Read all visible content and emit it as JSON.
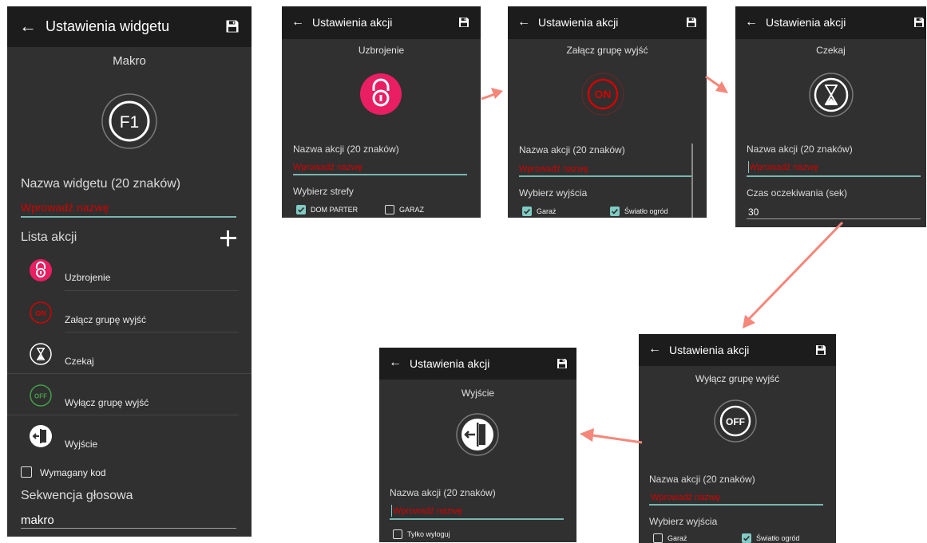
{
  "widget_screen": {
    "title": "Ustawienia widgetu",
    "subtitle": "Makro",
    "name_label": "Nazwa widgetu (20 znaków)",
    "name_placeholder": "Wprowadź nazwę",
    "actions_label": "Lista akcji",
    "actions": [
      {
        "label": "Uzbrojenie",
        "icon": "lock-icon"
      },
      {
        "label": "Załącz grupę wyjść",
        "icon": "on-icon"
      },
      {
        "label": "Czekaj",
        "icon": "hourglass-icon"
      },
      {
        "label": "Wyłącz grupę wyjść",
        "icon": "off-icon"
      },
      {
        "label": "Wyjście",
        "icon": "exit-door-icon"
      }
    ],
    "code_required_label": "Wymagany kod",
    "voice_label": "Sekwencja głosowa",
    "voice_value": "makro"
  },
  "arm_screen": {
    "title": "Ustawienia akcji",
    "subtitle": "Uzbrojenie",
    "name_label": "Nazwa akcji (20 znaków)",
    "name_placeholder": "Wprowadź nazwę",
    "select_label": "Wybierz strefy",
    "options": [
      {
        "label": "DOM PARTER",
        "checked": true
      },
      {
        "label": "GARAZ",
        "checked": false
      }
    ]
  },
  "on_screen": {
    "title": "Ustawienia akcji",
    "subtitle": "Załącz grupę wyjść",
    "name_label": "Nazwa akcji (20 znaków)",
    "name_placeholder": "Wprowadź nazwę",
    "select_label": "Wybierz wyjścia",
    "options": [
      {
        "label": "Garaż",
        "checked": true
      },
      {
        "label": "Światło ogród",
        "checked": true
      }
    ]
  },
  "wait_screen": {
    "title": "Ustawienia akcji",
    "subtitle": "Czekaj",
    "name_label": "Nazwa akcji (20 znaków)",
    "name_placeholder": "Wprowadź nazwę",
    "time_label": "Czas oczekiwania (sek)",
    "time_value": "30"
  },
  "off_screen": {
    "title": "Ustawienia akcji",
    "subtitle": "Wyłącz grupę wyjść",
    "name_label": "Nazwa akcji (20 znaków)",
    "name_placeholder": "Wprowadź nazwę",
    "select_label": "Wybierz wyjścia",
    "options": [
      {
        "label": "Garaż",
        "checked": false
      },
      {
        "label": "Światło ogród",
        "checked": true
      }
    ]
  },
  "exit_screen": {
    "title": "Ustawienia akcji",
    "subtitle": "Wyjście",
    "name_label": "Nazwa akcji (20 znaków)",
    "name_placeholder": "Wprowadź nazwę",
    "option_label": "Tylko wyloguj",
    "option_checked": false
  },
  "colors": {
    "panel_bg": "#303030",
    "appbar_bg": "#1c1c1c",
    "accent_pink": "#e91e63",
    "accent_red": "#d50000",
    "accent_green": "#43a047",
    "field_line": "#7ab7b0",
    "checkbox_on": "#80cbc4",
    "arrow": "#f4877a"
  }
}
